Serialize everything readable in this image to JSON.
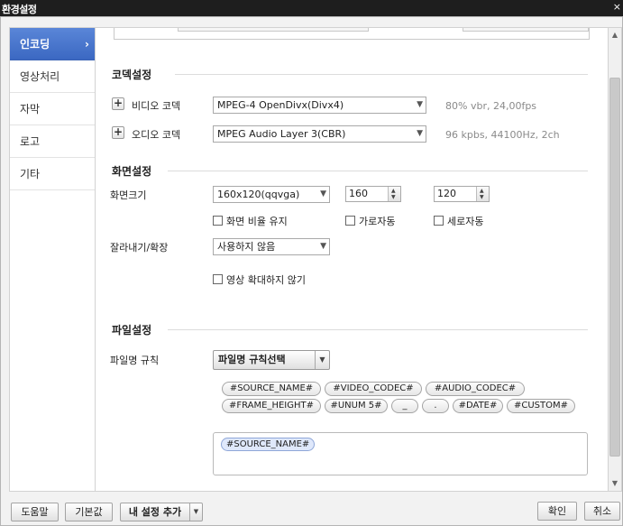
{
  "window": {
    "title": "환경설정",
    "close_glyph": "×"
  },
  "sidebar": {
    "items": [
      {
        "label": "인코딩",
        "active": true
      },
      {
        "label": "영상처리"
      },
      {
        "label": "자막"
      },
      {
        "label": "로고"
      },
      {
        "label": "기타"
      }
    ],
    "chevron": "›"
  },
  "codec": {
    "title": "코덱설정",
    "video_label": "비디오 코덱",
    "video_value": "MPEG-4 OpenDivx(Divx4)",
    "video_info": "80% vbr, 24,00fps",
    "audio_label": "오디오 코덱",
    "audio_value": "MPEG Audio Layer 3(CBR)",
    "audio_info": "96 kpbs, 44100Hz, 2ch",
    "plus_glyph": "+"
  },
  "screen": {
    "title": "화면설정",
    "size_label": "화면크기",
    "size_value": "160x120(qqvga)",
    "width": "160",
    "height": "120",
    "keep_ratio": "화면 비율 유지",
    "auto_width": "가로자동",
    "auto_height": "세로자동",
    "crop_label": "잘라내기/확장",
    "crop_value": "사용하지 않음",
    "no_zoom": "영상 확대하지 않기"
  },
  "file": {
    "title": "파일설정",
    "rule_label": "파일명 규칙",
    "rule_button": "파일명 규칙선택",
    "tags_row1": [
      "#SOURCE_NAME#",
      "#VIDEO_CODEC#",
      "#AUDIO_CODEC#"
    ],
    "tags_row2": [
      "#FRAME_HEIGHT#",
      "#UNUM 5#",
      "_",
      ".",
      "#DATE#",
      "#CUSTOM#"
    ],
    "current_tag": "#SOURCE_NAME#"
  },
  "footer": {
    "help": "도움말",
    "default": "기본값",
    "add_setting": "내 설정 추가",
    "ok": "확인",
    "cancel": "취소"
  },
  "icons": {
    "dropdown": "chevron-down-icon",
    "spin_up": "triangle-up-icon",
    "spin_down": "triangle-down-icon"
  }
}
